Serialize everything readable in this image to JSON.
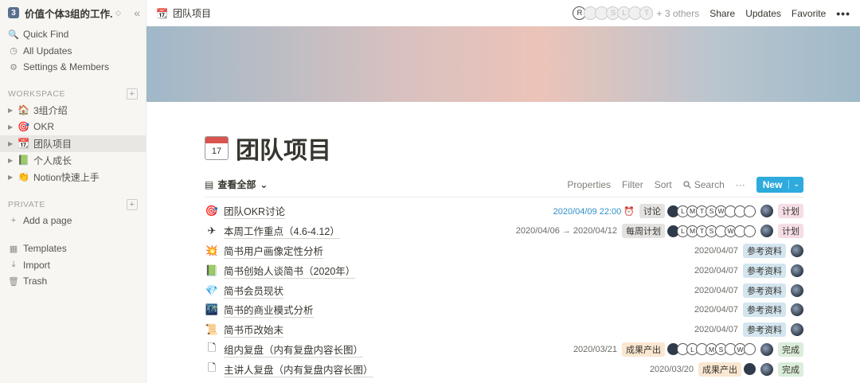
{
  "workspace": {
    "logo": "3",
    "name": "价值个体3组的工作...",
    "caret": "◇",
    "collapse": "«"
  },
  "nav": [
    {
      "icon": "search-icon",
      "glyph": "🔍",
      "label": "Quick Find"
    },
    {
      "icon": "clock-icon",
      "glyph": "◷",
      "label": "All Updates"
    },
    {
      "icon": "gear-icon",
      "glyph": "⚙",
      "label": "Settings & Members"
    }
  ],
  "workspace_section": {
    "label": "WORKSPACE",
    "plus": "+"
  },
  "tree": [
    {
      "emoji": "🏠",
      "label": "3组介绍",
      "active": false
    },
    {
      "emoji": "🎯",
      "label": "OKR",
      "active": false
    },
    {
      "emoji": "📆",
      "label": "团队项目",
      "active": true
    },
    {
      "emoji": "📗",
      "label": "个人成长",
      "active": false
    },
    {
      "emoji": "👏",
      "label": "Notion快速上手",
      "active": false
    }
  ],
  "private_section": {
    "label": "PRIVATE",
    "plus": "+"
  },
  "add_page": {
    "glyph": "+",
    "label": "Add a page"
  },
  "bottom_nav": [
    {
      "icon": "templates-icon",
      "glyph": "▦",
      "label": "Templates"
    },
    {
      "icon": "import-icon",
      "glyph": "⤓",
      "label": "Import"
    },
    {
      "icon": "trash-icon",
      "glyph": "🗑",
      "label": "Trash"
    }
  ],
  "topbar": {
    "crumb_emoji": "📆",
    "crumb": "团队项目",
    "avatars": [
      {
        "letter": "R",
        "dim": false
      },
      {
        "letter": "",
        "dim": true
      },
      {
        "letter": "",
        "dim": true
      },
      {
        "letter": "S",
        "dim": true
      },
      {
        "letter": "L",
        "dim": true
      },
      {
        "letter": "",
        "dim": true
      },
      {
        "letter": "T",
        "dim": true
      }
    ],
    "others": "+ 3 others",
    "share": "Share",
    "updates": "Updates",
    "favorite": "Favorite",
    "more": "•••"
  },
  "page": {
    "icon_num": "17",
    "title": "团队项目"
  },
  "view": {
    "icon": "▤",
    "name": "查看全部",
    "caret": "⌄",
    "properties": "Properties",
    "filter": "Filter",
    "sort": "Sort",
    "search": "Search",
    "more": "···",
    "new": "New",
    "new_caret": "⌄"
  },
  "rows": [
    {
      "emoji": "🎯",
      "title": "团队OKR讨论",
      "date": "2020/04/09 22:00 ⏰",
      "date_blue": true,
      "tag": "讨论",
      "tag_color": "gray",
      "avs": [
        "",
        "L",
        "M",
        "T",
        "S",
        "W",
        "",
        "",
        ""
      ],
      "status": "计划",
      "status_color": "pink"
    },
    {
      "emoji": "✈",
      "title": "本周工作重点（4.6-4.12）",
      "date": "2020/04/06 → 2020/04/12",
      "date_blue": false,
      "tag": "每周计划",
      "tag_color": "gray",
      "avs": [
        "",
        "L",
        "M",
        "T",
        "S",
        "",
        "W",
        "",
        ""
      ],
      "status": "计划",
      "status_color": "pink"
    },
    {
      "emoji": "💥",
      "title": "简书用户画像定性分析",
      "date": "2020/04/07",
      "date_blue": false,
      "tag": "参考资料",
      "tag_color": "blue",
      "avs": [],
      "status": "",
      "status_color": ""
    },
    {
      "emoji": "📗",
      "title": "简书创始人谈简书（2020年）",
      "date": "2020/04/07",
      "date_blue": false,
      "tag": "参考资料",
      "tag_color": "blue",
      "avs": [],
      "status": "",
      "status_color": ""
    },
    {
      "emoji": "💎",
      "title": "简书会员现状",
      "date": "2020/04/07",
      "date_blue": false,
      "tag": "参考资料",
      "tag_color": "blue",
      "avs": [],
      "status": "",
      "status_color": ""
    },
    {
      "emoji": "🌃",
      "title": "简书的商业模式分析",
      "date": "2020/04/07",
      "date_blue": false,
      "tag": "参考资料",
      "tag_color": "blue",
      "avs": [],
      "status": "",
      "status_color": ""
    },
    {
      "emoji": "📜",
      "title": "简书币改始末",
      "date": "2020/04/07",
      "date_blue": false,
      "tag": "参考资料",
      "tag_color": "blue",
      "avs": [],
      "status": "",
      "status_color": ""
    },
    {
      "emoji": "🗋",
      "title": "组内复盘（内有复盘内容长图）",
      "date": "2020/03/21",
      "date_blue": false,
      "tag": "成果产出",
      "tag_color": "orange",
      "avs": [
        "",
        "",
        "L",
        "",
        "M",
        "S",
        "",
        "W",
        ""
      ],
      "status": "完成",
      "status_color": "green"
    },
    {
      "emoji": "🗋",
      "title": "主讲人复盘（内有复盘内容长图）",
      "date": "2020/03/20",
      "date_blue": false,
      "tag": "成果产出",
      "tag_color": "orange",
      "avs": [
        ""
      ],
      "status": "完成",
      "status_color": "green"
    }
  ]
}
